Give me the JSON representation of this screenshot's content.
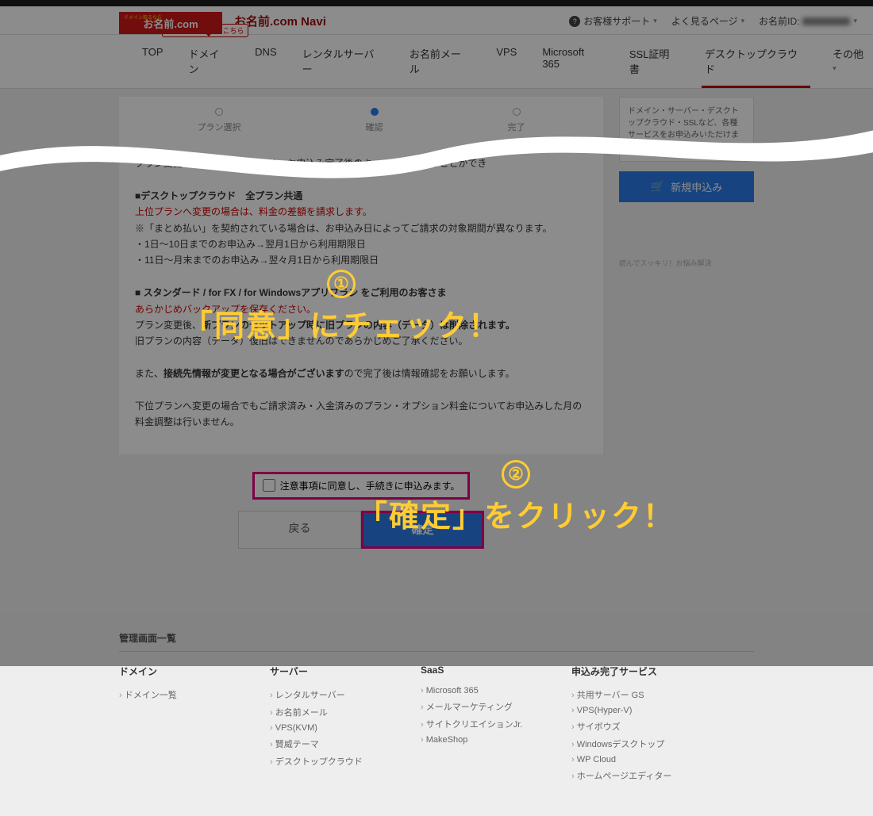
{
  "logo": {
    "main": "お名前.com",
    "tag": "ドメイン取るなら"
  },
  "naviTitle": "お名前.com Navi",
  "topLinks": {
    "support": "お客様サポート",
    "frequently": "よく見るページ",
    "userIdLabel": "お名前ID:"
  },
  "nav": {
    "top": "TOP",
    "domain": "ドメイン",
    "domainBadge": "ドメインの設定はこちら",
    "dns": "DNS",
    "rental": "レンタルサーバー",
    "mail": "お名前メール",
    "vps": "VPS",
    "ms365": "Microsoft 365",
    "ssl": "SSL証明書",
    "desktop": "デスクトップクラウド",
    "other": "その他"
  },
  "stepper": {
    "s1": "プラン選択",
    "s2": "確認",
    "s3": "完了"
  },
  "side": {
    "boxText": "ドメイン・サーバー・デスクトップクラウド・SSLなど、各種サービスをお申込みいただけます",
    "applyBtn": "新規申込み",
    "note": "読んでスッキリ！お悩み解決"
  },
  "content": {
    "line1": "プラン変更手続きにつきましては、お申込み完了後のキャンセルは承ることができ",
    "h1": "■デスクトップクラウド　全プラン共通",
    "red1": "上位プランへ変更の場合は、料金の差額を請求します。",
    "l2": "※「まとめ払い」を契約されている場合は、お申込み日によってご請求の対象期間が異なります。",
    "l3": "・1日～10日までのお申込み→翌月1日から利用期限日",
    "l4": "・11日～月末までのお申込み→翌々月1日から利用期限日",
    "h2": "■ スタンダード / for FX / for Windowsアプリプラン をご利用のお客さま",
    "red2": "あらかじめバックアップを保存ください。",
    "l5a": "プラン変更後、",
    "l5b": "新プランのセットアップ時に旧プランの内容（データ）は削除されます。",
    "l6": "旧プランの内容（データ）復旧はできませんのであらかじめご了承ください。",
    "l7a": "また、",
    "l7b": "接続先情報が変更となる場合がございます",
    "l7c": "ので完了後は情報確認をお願いします。",
    "l8": "下位プランへ変更の場合でもご請求済み・入金済みのプラン・オプション料金についてお申込みした月の料金調整は行いません。"
  },
  "agree": {
    "label": "注意事項に同意し、手続きに申込みます。"
  },
  "buttons": {
    "back": "戻る",
    "confirm": "確定"
  },
  "footer": {
    "title": "管理画面一覧",
    "col1": {
      "h": "ドメイン",
      "items": [
        "ドメイン一覧"
      ]
    },
    "col2": {
      "h": "サーバー",
      "items": [
        "レンタルサーバー",
        "お名前メール",
        "VPS(KVM)",
        "賢威テーマ",
        "デスクトップクラウド"
      ]
    },
    "col3": {
      "h": "SaaS",
      "items": [
        "Microsoft 365",
        "メールマーケティング",
        "サイトクリエイションJr.",
        "MakeShop"
      ]
    },
    "col4": {
      "h": "申込み完了サービス",
      "items": [
        "共用サーバー GS",
        "VPS(Hyper-V)",
        "サイボウズ",
        "Windowsデスクトップ",
        "WP Cloud",
        "ホームページエディター"
      ]
    }
  },
  "anno": {
    "n1": "①",
    "t1": "「同意」にチェック！",
    "n2": "②",
    "t2": "「確定」をクリック！"
  }
}
